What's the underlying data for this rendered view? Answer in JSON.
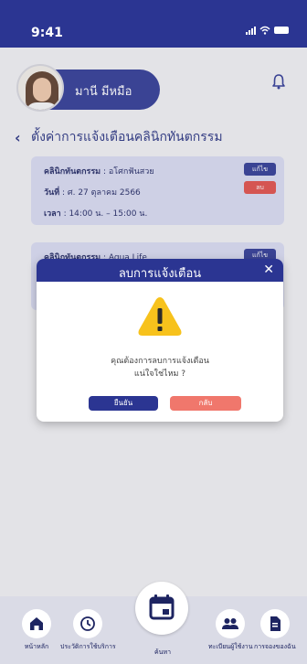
{
  "status_bar": {
    "time": "9:41"
  },
  "profile": {
    "name": "มานี มีหมือ"
  },
  "page": {
    "title": "ตั้งค่าการแจ้งเตือนคลินิกทันตกรรม"
  },
  "cards": [
    {
      "clinic_label": "คลินิกทันตกรรม",
      "clinic_value": " : อโศกฟันสวย",
      "date_label": "วันที่",
      "date_value": " : ศ. 27 ตุลาคม 2566",
      "time_label": "เวลา",
      "time_value": " : 14:00 น. – 15:00 น.",
      "edit_label": "แก้ไข",
      "delete_label": "ลบ"
    },
    {
      "clinic_label": "คลินิกทันตกรรม",
      "clinic_value": " : Aqua Life",
      "edit_label": "แก้ไข"
    }
  ],
  "modal": {
    "title": "ลบการแจ้งเตือน",
    "message_line1": "คุณต้องการลบการแจ้งเตือน",
    "message_line2": "แน่ใจใช่ไหม ?",
    "confirm_label": "ยืนยัน",
    "back_label": "กลับ"
  },
  "nav": {
    "home": "หน้าหลัก",
    "history": "ประวัติการใช้บริการ",
    "search": "ค้นหา",
    "register": "ทะเบียนผู้ใช้งาน",
    "booking": "การจองของฉัน"
  },
  "colors": {
    "primary": "#2b3592",
    "danger": "#e14a45",
    "back": "#f0776c",
    "warning": "#f7c21c"
  }
}
